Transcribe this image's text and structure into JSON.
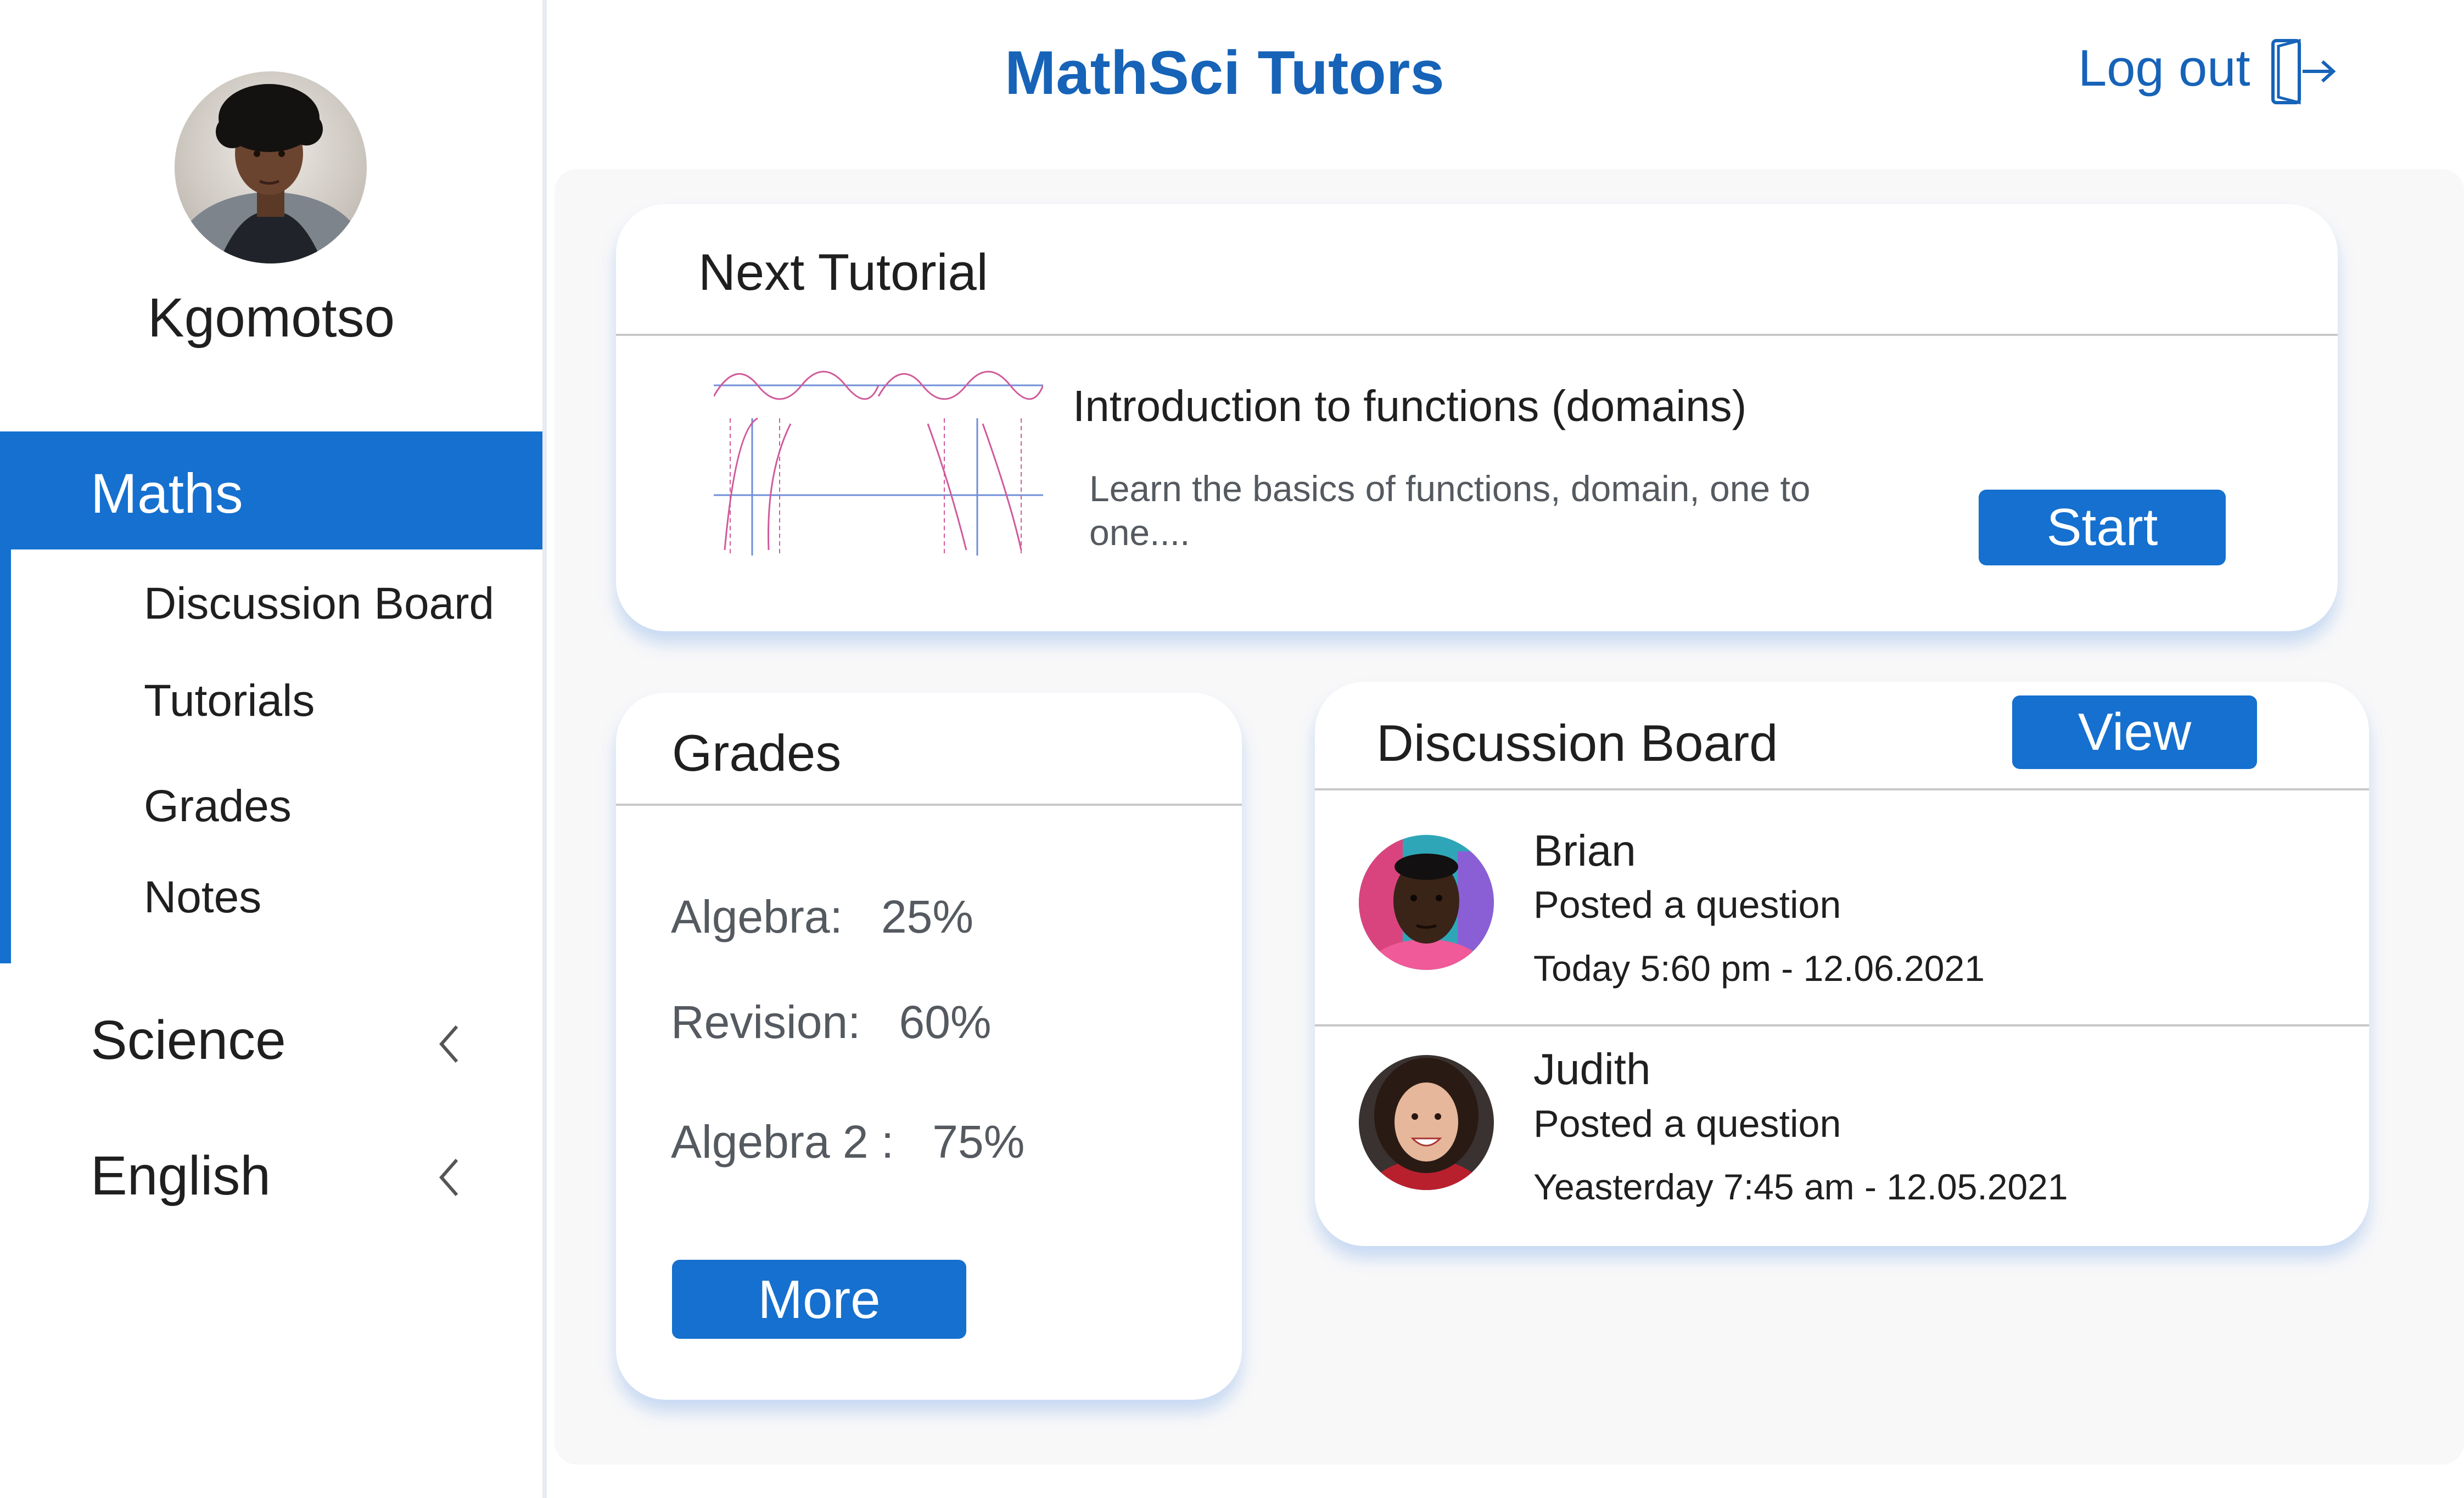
{
  "sidebar": {
    "user_name": "Kgomotso",
    "active_subject": "Maths",
    "subnav": [
      "Discussion Board",
      "Tutorials",
      "Grades",
      "Notes"
    ],
    "subjects": [
      "Science",
      "English"
    ]
  },
  "header": {
    "title": "MathSci Tutors",
    "logout_label": "Log out",
    "logout_icon": "logout-icon"
  },
  "next_tutorial": {
    "heading": "Next Tutorial",
    "title": "Introduction to functions (domains)",
    "description": "Learn the basics of functions, domain, one to one....",
    "start_label": "Start"
  },
  "grades": {
    "heading": "Grades",
    "rows": [
      {
        "label": "Algebra:",
        "value": "25%"
      },
      {
        "label": "Revision:",
        "value": "60%"
      },
      {
        "label": "Algebra 2 :",
        "value": "75%"
      }
    ],
    "more_label": "More"
  },
  "discussion": {
    "heading": "Discussion Board",
    "view_label": "View",
    "posts": [
      {
        "name": "Brian",
        "action": "Posted a question",
        "time": "Today 5:60 pm - 12.06.2021"
      },
      {
        "name": "Judith",
        "action": "Posted a question",
        "time": "Yeasterday 7:45 am - 12.05.2021"
      }
    ]
  },
  "colors": {
    "accent": "#1570cf",
    "title_blue": "#1663b8"
  }
}
